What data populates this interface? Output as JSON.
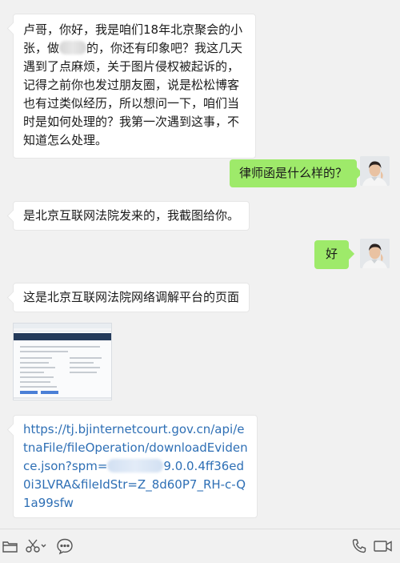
{
  "messages": {
    "m1_part1": "卢哥，你好，我是咱们18年北京聚会的小张，做",
    "m1_part2": "的，你还有印象吧？我这几天遇到了点麻烦，关于图片侵权被起诉的，记得之前你也发过朋友圈，说是松松博客也有过类似经历，所以想问一下，咱们当时是如何处理的？我第一次遇到这事，不知道怎么处理。",
    "m2": "律师函是什么样的？",
    "m3": "是北京互联网法院发来的，我截图给你。",
    "m4": "好",
    "m5": "这是北京互联网法院网络调解平台的页面",
    "m7_part1": "https://tj.bjinternetcourt.gov.cn/api/etnaFile/fileOperation/downloadEvidence.json?spm=",
    "m7_part2": "9.0.0.4ff36ed0i3LVRA&fileIdStr=Z_8d60P7_RH-c-Q1a99sfw"
  },
  "colors": {
    "outgoing_bubble": "#9eea6a",
    "incoming_bubble": "#ffffff",
    "link": "#2e6fb5",
    "background": "#f1f1f1"
  },
  "toolbar": {
    "left_icons": [
      "folder-icon",
      "scissors-icon",
      "emoji-icon"
    ],
    "right_icons": [
      "phone-icon",
      "video-call-icon"
    ]
  }
}
